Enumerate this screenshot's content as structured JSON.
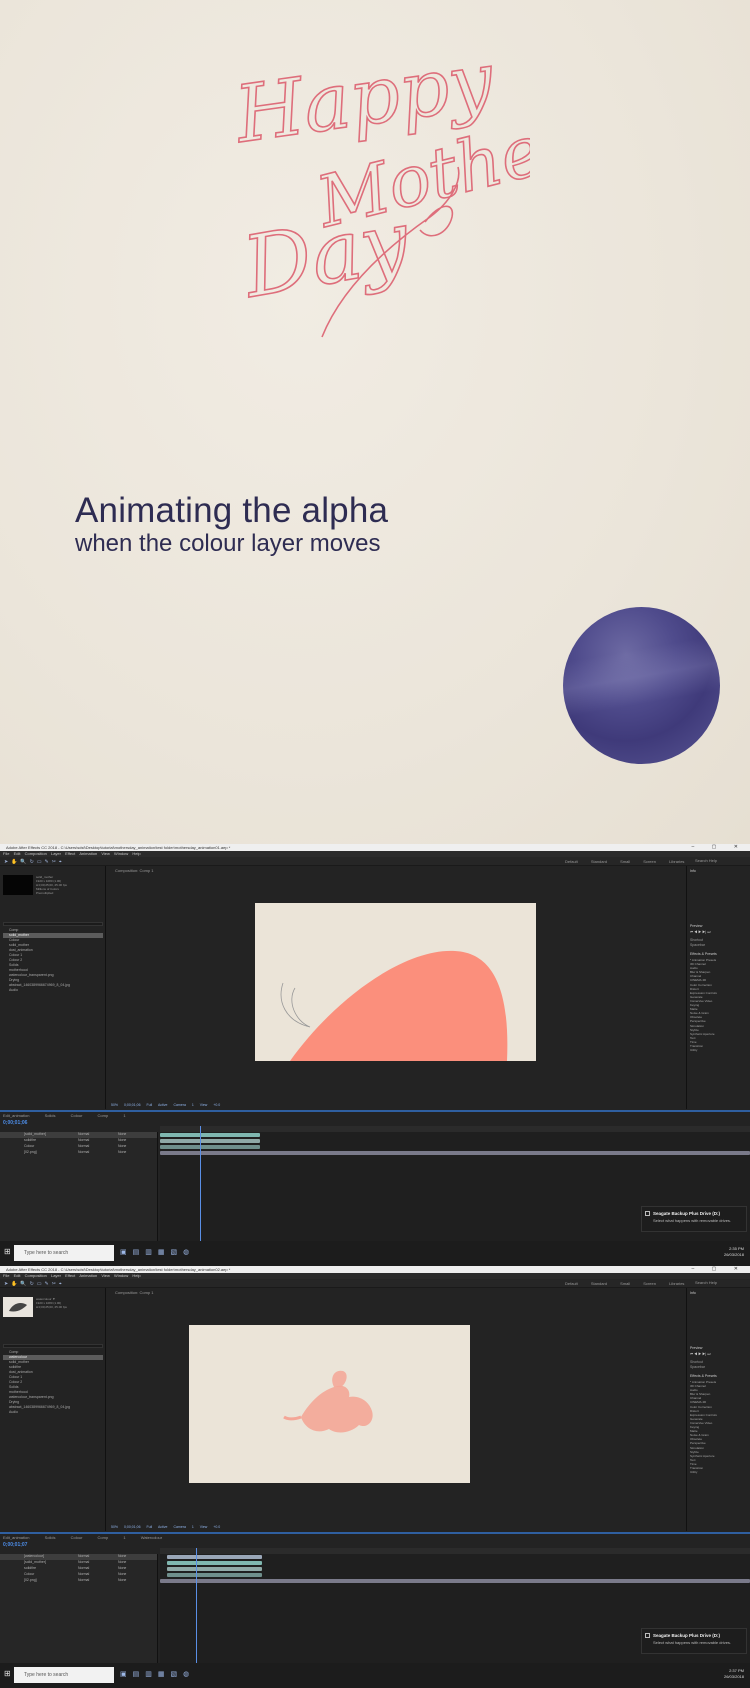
{
  "title_card": {
    "lettering": [
      "Happy",
      "Mother",
      "Day"
    ],
    "title": "Animating the alpha",
    "subtitle": "when the colour layer moves",
    "colors": {
      "lettering": "#de6e7b",
      "text": "#2e2c52",
      "blob": "#4a4688",
      "background": "#ece6db"
    }
  },
  "screens": [
    {
      "titlebar": "Adobe After Effects CC 2018 - C:\\Users\\sdsf\\Desktop\\tutorial\\mothersday_animation\\test folder\\mothersday_animation01.aep *",
      "menu": [
        "File",
        "Edit",
        "Composition",
        "Layer",
        "Effect",
        "Animation",
        "View",
        "Window",
        "Help"
      ],
      "workspaces": [
        "Default",
        "Standard",
        "Small Screen",
        "Libraries"
      ],
      "search_help": "Search Help",
      "project_tab": "Project",
      "project_meta": [
        "solid_mother",
        "1920 x 1080 (1.00)",
        "Δ 0;00;25;00, 25.00 fps",
        "Millions of Colors",
        "Premultiplied"
      ],
      "project_items": [
        "Comp",
        "solid_mother",
        "Colour",
        "solid_mother",
        "dust_animation",
        "Colour 1",
        "Colour 2",
        "Solids",
        "motherhood",
        "watercolour_transparent.png",
        "Drying",
        "abstract_1460389966674969_8_04.jpg",
        "Audio"
      ],
      "selected_item": 1,
      "viewer_tab": "Composition: Comp 1",
      "viewer_footer": [
        "50%",
        "0;00;01;06",
        "Full",
        "Active Camera",
        "1 View",
        "+0.0"
      ],
      "right_panel": {
        "info": "Info",
        "preview": "Preview",
        "shortcut": "Shortcut",
        "spacebar": "Spacebar",
        "effects": "Effects & Presets"
      },
      "effects_list": [
        "* Animation Presets",
        "3D Channel",
        "Audio",
        "Blur & Sharpen",
        "Channel",
        "CINEMA 4D",
        "Color Correction",
        "Distort",
        "Expression Controls",
        "Generate",
        "Immersive Video",
        "Keying",
        "Matte",
        "Noise & Grain",
        "Obsolete",
        "Perspective",
        "Simulation",
        "Stylize",
        "Synthetic Aperture",
        "Text",
        "Time",
        "Transition",
        "Utility"
      ],
      "timeline_tabs": [
        "Edit_animation",
        "Solids",
        "Colour",
        "Comp 1"
      ],
      "timecode": "0;00;01;06",
      "layers": [
        {
          "num": "1",
          "name": "[solid_mother]",
          "mode": "Normal",
          "parent": "None",
          "sel": true
        },
        {
          "num": "2",
          "name": "solidfire",
          "mode": "Normal",
          "parent": "None",
          "sel": false
        },
        {
          "num": "3",
          "name": "Colour",
          "mode": "Normal",
          "parent": "None",
          "sel": false
        },
        {
          "num": "4",
          "name": "[02.png]",
          "mode": "Normal",
          "parent": "None",
          "sel": false
        }
      ],
      "notification": {
        "title": "Seagate Backup Plus Drive (D:)",
        "body": "Select what happens with removable drives."
      },
      "taskbar": {
        "search": "Type here to search",
        "time": "2:35 PM",
        "date": "26/03/2018"
      },
      "frame_bg": "#ebe4d8",
      "shape_color": "#fb8f7c"
    },
    {
      "titlebar": "Adobe After Effects CC 2018 - C:\\Users\\sdsf\\Desktop\\tutorial\\mothersday_animation\\test folder\\mothersday_animation02.aep *",
      "menu": [
        "File",
        "Edit",
        "Composition",
        "Layer",
        "Effect",
        "Animation",
        "View",
        "Window",
        "Help"
      ],
      "workspaces": [
        "Default",
        "Standard",
        "Small Screen",
        "Libraries"
      ],
      "search_help": "Search Help",
      "project_tab": "Project",
      "project_meta": [
        "watercolour ▼",
        "1920 x 1080 (1.00)",
        "Δ 0;00;25;00, 25.00 fps"
      ],
      "project_items": [
        "Comp",
        "watercolour",
        "solid_mother",
        "solidfire",
        "dust_animation",
        "Colour 1",
        "Colour 2",
        "Solids",
        "motherhood",
        "watercolour_transparent.png",
        "Drying",
        "abstract_1460389966674969_8_04.jpg",
        "Audio"
      ],
      "selected_item": 1,
      "viewer_tab": "Composition: Comp 1",
      "viewer_footer": [
        "50%",
        "0;00;01;06",
        "Full",
        "Active Camera",
        "1 View",
        "+0.0"
      ],
      "right_panel": {
        "info": "Info",
        "preview": "Preview",
        "shortcut": "Shortcut",
        "spacebar": "Spacebar",
        "effects": "Effects & Presets"
      },
      "effects_list": [
        "* Animation Presets",
        "3D Channel",
        "Audio",
        "Blur & Sharpen",
        "Channel",
        "CINEMA 4D",
        "Color Correction",
        "Distort",
        "Expression Controls",
        "Generate",
        "Immersive Video",
        "Keying",
        "Matte",
        "Noise & Grain",
        "Obsolete",
        "Perspective",
        "Simulation",
        "Stylize",
        "Synthetic Aperture",
        "Text",
        "Time",
        "Transition",
        "Utility"
      ],
      "timeline_tabs": [
        "Edit_animation",
        "Solids",
        "Colour",
        "Comp 1",
        "Watercolour"
      ],
      "timecode": "0;00;01;07",
      "layers": [
        {
          "num": "1",
          "name": "[watercolour]",
          "mode": "Normal",
          "parent": "None",
          "sel": true
        },
        {
          "num": "2",
          "name": "[solid_mother]",
          "mode": "Normal",
          "parent": "None",
          "sel": false
        },
        {
          "num": "3",
          "name": "solidfire",
          "mode": "Normal",
          "parent": "None",
          "sel": false
        },
        {
          "num": "4",
          "name": "Colour",
          "mode": "Normal",
          "parent": "None",
          "sel": false
        },
        {
          "num": "5",
          "name": "[02.png]",
          "mode": "Normal",
          "parent": "None",
          "sel": false
        }
      ],
      "notification": {
        "title": "Seagate Backup Plus Drive (D:)",
        "body": "Select what happens with removable drives."
      },
      "taskbar": {
        "search": "Type here to search",
        "time": "2:37 PM",
        "date": "26/03/2018"
      },
      "frame_bg": "#ebe4d8",
      "shape_color": "#f4a697"
    }
  ]
}
